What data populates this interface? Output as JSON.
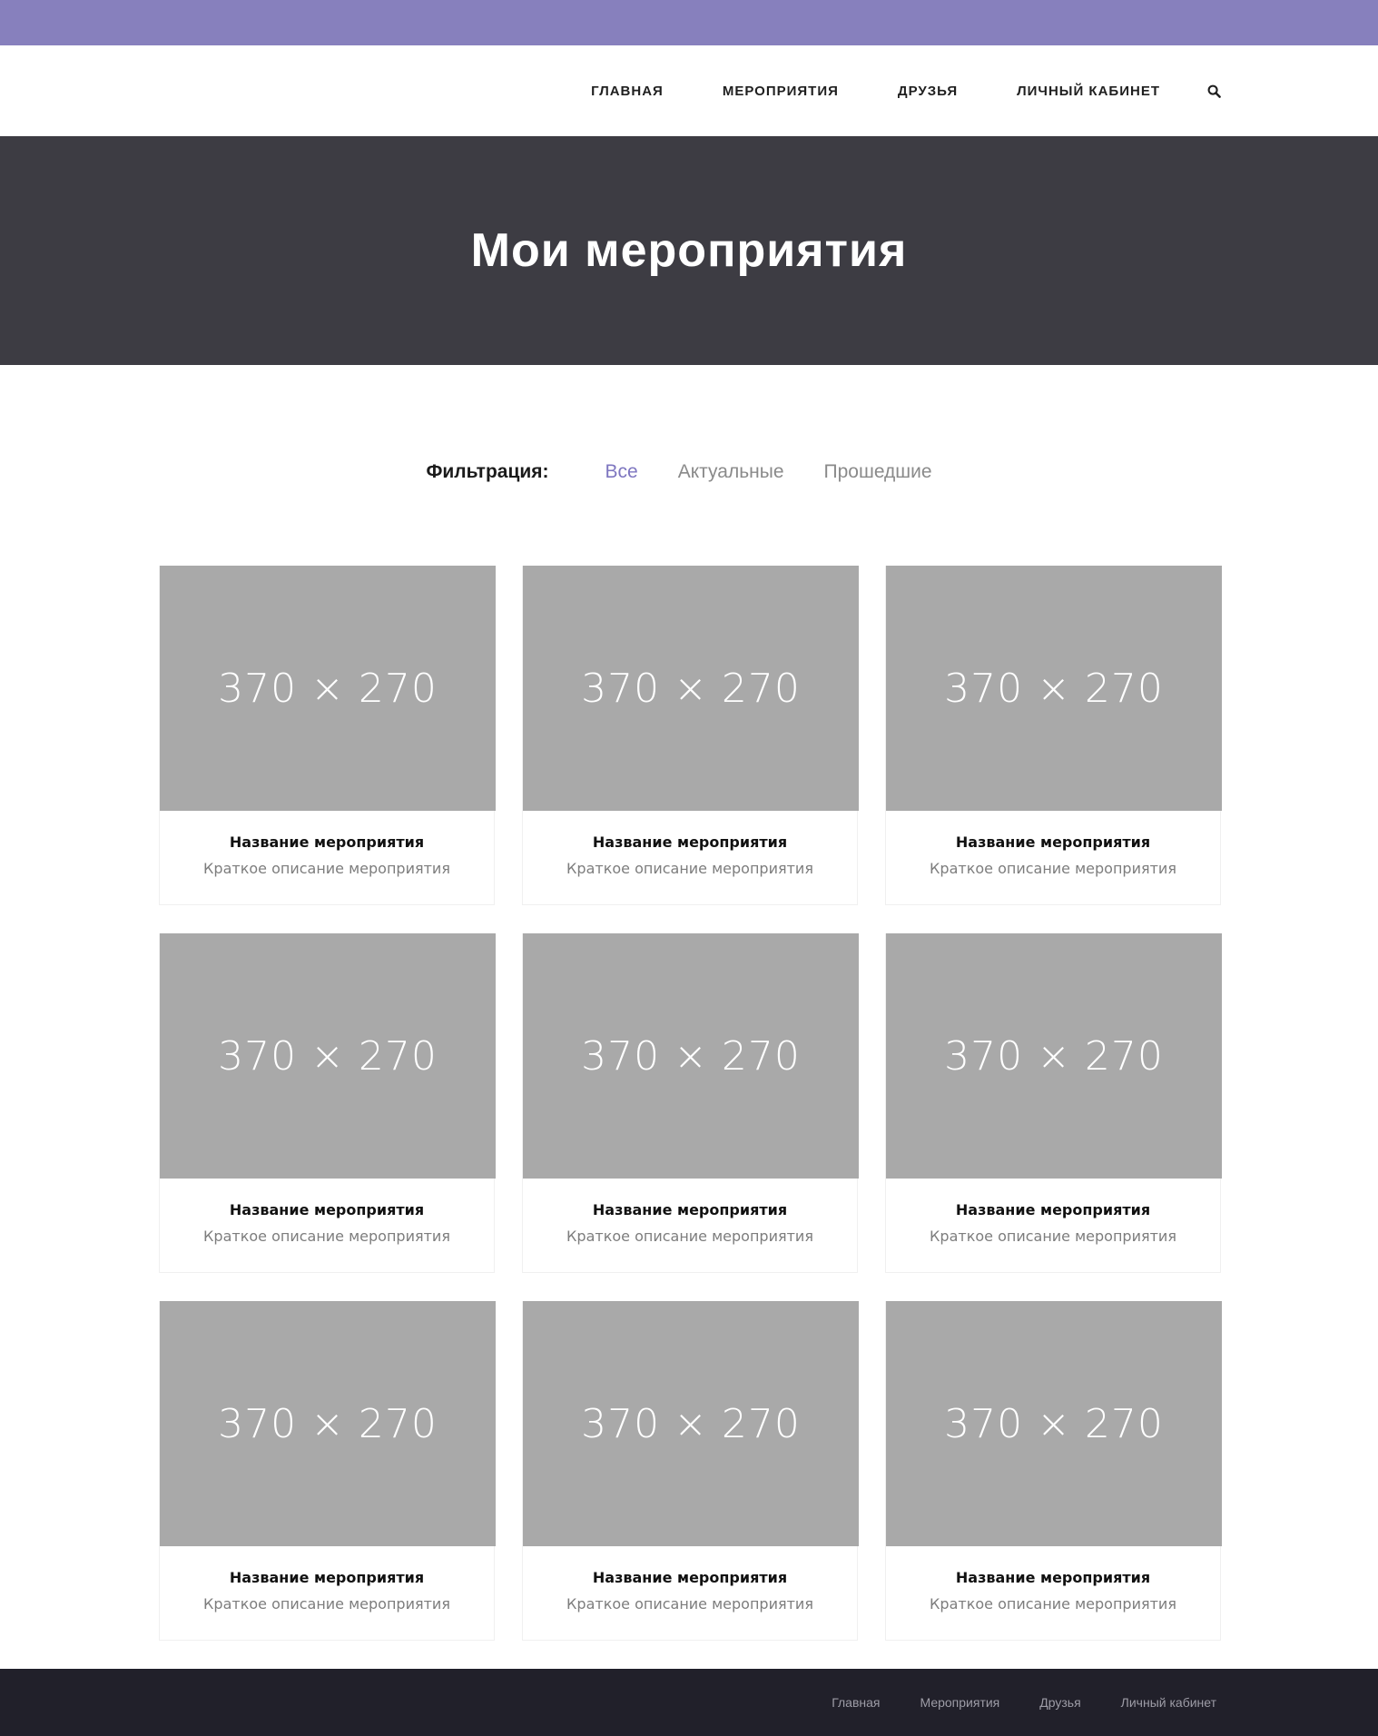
{
  "colors": {
    "topbar": "#8780bd",
    "hero_background": "#3d3c43",
    "accent": "#7e76c0",
    "placeholder": "#a9a9a9",
    "footer_background": "#21202a"
  },
  "header": {
    "nav": [
      {
        "label": "ГЛАВНАЯ"
      },
      {
        "label": "МЕРОПРИЯТИЯ"
      },
      {
        "label": "ДРУЗЬЯ"
      },
      {
        "label": "ЛИЧНЫЙ КАБИНЕТ"
      }
    ],
    "search_icon": "search-icon"
  },
  "hero": {
    "title": "Мои мероприятия"
  },
  "filters": {
    "label": "Фильтрация:",
    "options": [
      {
        "label": "Все",
        "active": true
      },
      {
        "label": "Актуальные",
        "active": false
      },
      {
        "label": "Прошедшие",
        "active": false
      }
    ]
  },
  "events": [
    {
      "image": "370 × 270",
      "title": "Название мероприятия",
      "description": "Краткое описание мероприятия"
    },
    {
      "image": "370 × 270",
      "title": "Название мероприятия",
      "description": "Краткое описание мероприятия"
    },
    {
      "image": "370 × 270",
      "title": "Название мероприятия",
      "description": "Краткое описание мероприятия"
    },
    {
      "image": "370 × 270",
      "title": "Название мероприятия",
      "description": "Краткое описание мероприятия"
    },
    {
      "image": "370 × 270",
      "title": "Название мероприятия",
      "description": "Краткое описание мероприятия"
    },
    {
      "image": "370 × 270",
      "title": "Название мероприятия",
      "description": "Краткое описание мероприятия"
    },
    {
      "image": "370 × 270",
      "title": "Название мероприятия",
      "description": "Краткое описание мероприятия"
    },
    {
      "image": "370 × 270",
      "title": "Название мероприятия",
      "description": "Краткое описание мероприятия"
    },
    {
      "image": "370 × 270",
      "title": "Название мероприятия",
      "description": "Краткое описание мероприятия"
    }
  ],
  "footer": {
    "links": [
      {
        "label": "Главная"
      },
      {
        "label": "Мероприятия"
      },
      {
        "label": "Друзья"
      },
      {
        "label": "Личный кабинет"
      }
    ]
  }
}
